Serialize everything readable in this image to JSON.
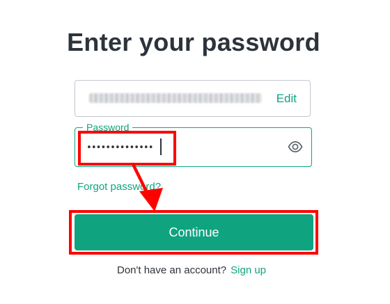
{
  "page": {
    "title": "Enter your password"
  },
  "email": {
    "edit_label": "Edit"
  },
  "password": {
    "label": "Password",
    "value": "••••••••••••••",
    "toggle_icon": "eye-icon"
  },
  "links": {
    "forgot_password": "Forgot password?"
  },
  "actions": {
    "continue_label": "Continue"
  },
  "signup": {
    "prompt": "Don't have an account?",
    "link": "Sign up"
  },
  "colors": {
    "accent": "#10a37f",
    "text": "#2d333a",
    "annotation": "#ff0000"
  }
}
